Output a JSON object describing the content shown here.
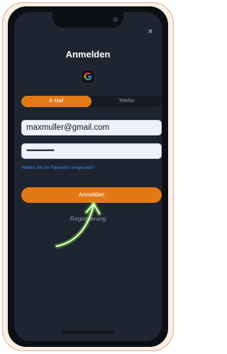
{
  "dialog": {
    "title": "Anmelden",
    "close_symbol": "×"
  },
  "social": {
    "google_icon": "google-icon"
  },
  "tabs": [
    {
      "label": "E-Mail",
      "active": true
    },
    {
      "label": "Telefon",
      "active": false
    }
  ],
  "form": {
    "email_value": "maxmuller@gmail.com",
    "password_masked": "••••••••••••••••••",
    "forgot_link": "Haben Sie Ihr Passwort vergessen?",
    "submit_label": "Anmelden"
  },
  "register": {
    "label": "Registrierung"
  },
  "colors": {
    "accent": "#e17a16",
    "background": "#1e2430",
    "link": "#3d8bff",
    "arrow_glow": "#7dff2e"
  }
}
